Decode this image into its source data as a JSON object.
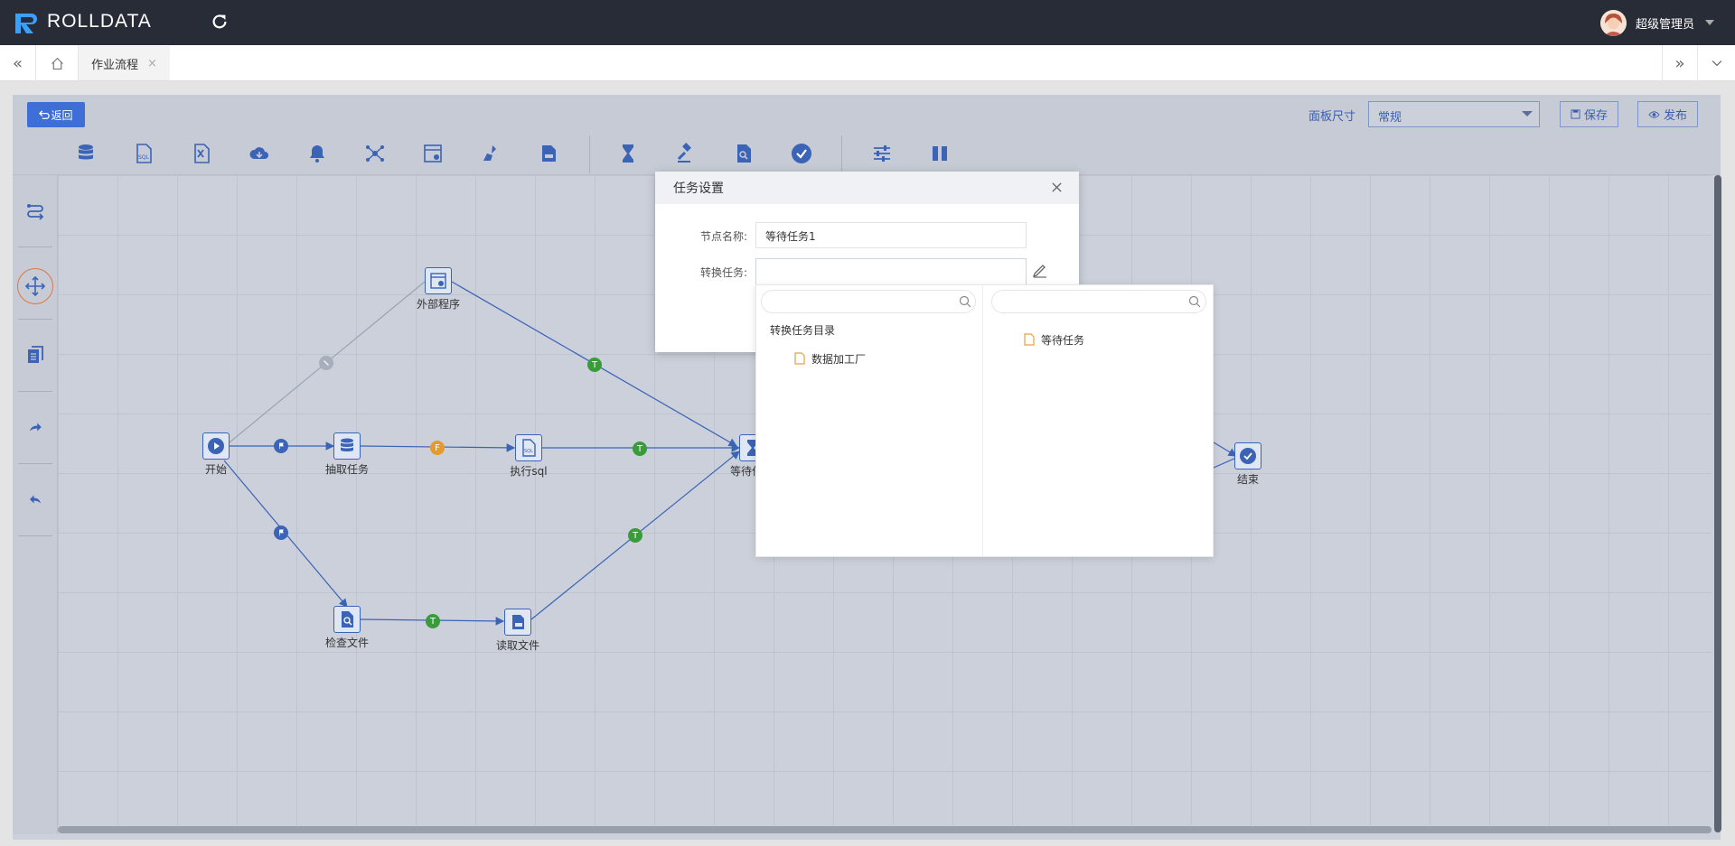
{
  "app": {
    "brand": "ROLLDATA",
    "user": "超级管理员"
  },
  "tabs": [
    {
      "label": "作业流程",
      "close": "×"
    }
  ],
  "designer": {
    "back_label": "返回",
    "size_label": "面板尺寸",
    "size_value": "常规",
    "save_label": "保存",
    "publish_label": "发布"
  },
  "nodes": {
    "start": "开始",
    "extract": "抽取任务",
    "exec_sql": "执行sql",
    "external": "外部程序",
    "wait": "等待任",
    "check_file": "检查文件",
    "read_file": "读取文件",
    "end": "结束"
  },
  "badges": {
    "true": "T",
    "false": "F"
  },
  "dialog": {
    "title": "任务设置",
    "node_name_label": "节点名称:",
    "node_name_value": "等待任务1",
    "convert_label": "转换任务:",
    "convert_value": ""
  },
  "dropdown": {
    "left_search_placeholder": "",
    "right_search_placeholder": "",
    "tree_root": "转换任务目录",
    "tree_child": "数据加工厂",
    "right_item": "等待任务"
  },
  "colors": {
    "accent": "#3b63b6",
    "header_bg": "#282c37",
    "true_badge": "#3a9b3a",
    "false_badge": "#e39b2c"
  }
}
